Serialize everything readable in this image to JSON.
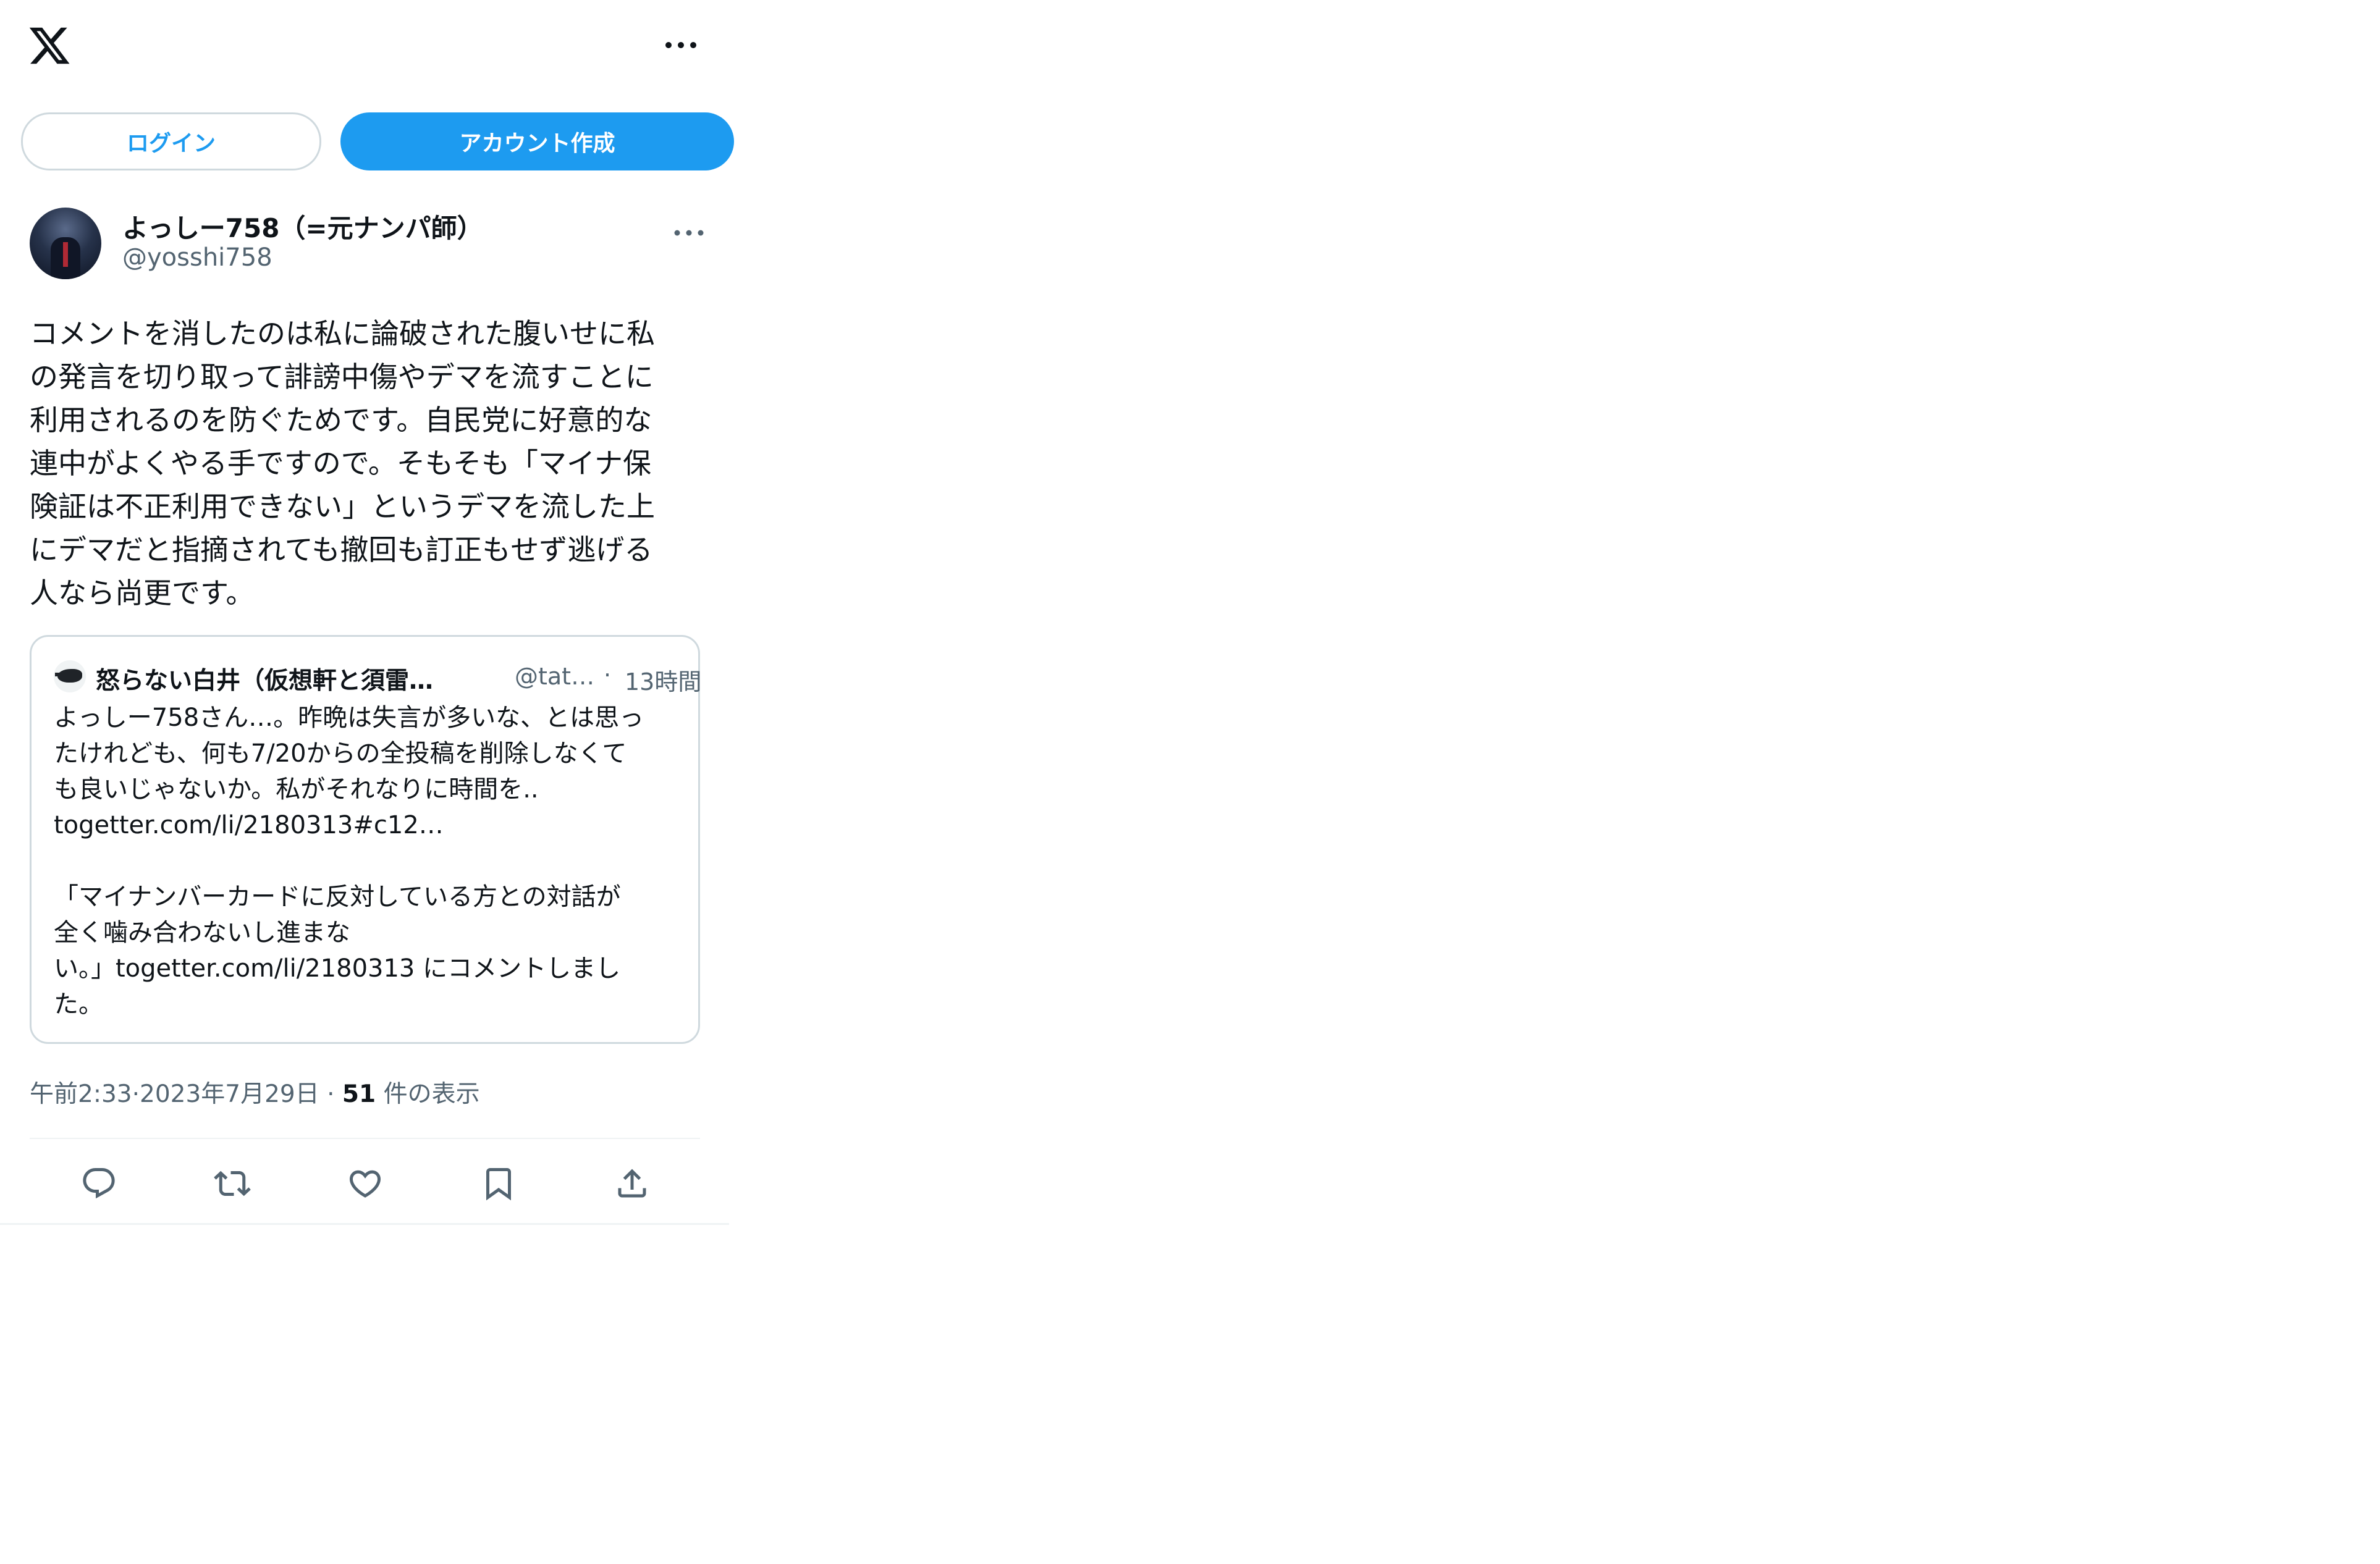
{
  "header": {
    "logo_icon": "x-logo-icon",
    "more_icon": "more-horizontal-icon"
  },
  "auth": {
    "login_label": "ログイン",
    "signup_label": "アカウント作成"
  },
  "tweet": {
    "author_name": "よっしー758（=元ナンパ師）",
    "author_handle": "@yosshi758",
    "text": "コメントを消したのは私に論破された腹いせに私\nの発言を切り取って誹謗中傷やデマを流すことに\n利用されるのを防ぐためです。自民党に好意的な\n連中がよくやる手ですので。そもそも「マイナ保\n険証は不正利用できない」というデマを流した上\nにデマだと指摘されても撤回も訂正もせず逃げる\n人なら尚更です。",
    "quote": {
      "author_name": "怒らない白井（仮想軒と須雷…",
      "author_handle": "@tat…",
      "separator": "·",
      "time": "13時間",
      "text": "よっしー758さん…。昨晩は失言が多いな、とは思っ\nたけれども、何も7/20からの全投稿を削除しなくて\nも良いじゃないか。私がそれなりに時間を..\ntogetter.com/li/2180313#c12…\n\n「マイナンバーカードに反対している方との対話が\n全く噛み合わないし進まな\nい。」togetter.com/li/2180313 にコメントしまし\nた。"
    },
    "time": "午前2:33",
    "date": "2023年7月29日",
    "meta_separator": "·",
    "views_count": "51",
    "views_label": "件の表示"
  },
  "actions": [
    {
      "icon": "reply-icon"
    },
    {
      "icon": "retweet-icon"
    },
    {
      "icon": "like-icon"
    },
    {
      "icon": "bookmark-icon"
    },
    {
      "icon": "share-icon"
    }
  ],
  "colors": {
    "accent": "#1d9bf0",
    "text": "#0f1419",
    "secondary_text": "#536471",
    "border": "#cfd9de"
  }
}
